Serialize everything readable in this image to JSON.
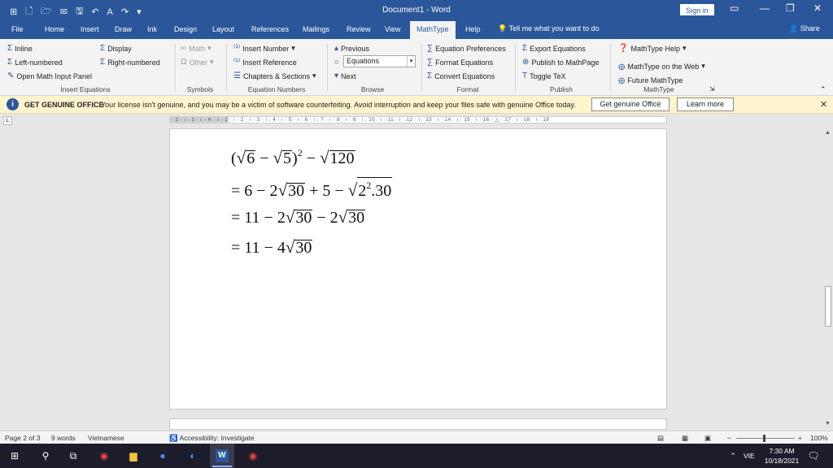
{
  "window": {
    "title": "Document1 - Word",
    "sign_in": "Sign in"
  },
  "tabs": [
    "File",
    "Home",
    "Insert",
    "Draw",
    "Ink",
    "Design",
    "Layout",
    "References",
    "Mailings",
    "Review",
    "View",
    "MathType",
    "Help"
  ],
  "active_tab": "MathType",
  "tell_me": "Tell me what you want to do",
  "share": "Share",
  "ribbon": {
    "insert_equations": {
      "label": "Insert Equations",
      "inline": "Inline",
      "display": "Display",
      "left_numbered": "Left-numbered",
      "right_numbered": "Right-numbered",
      "open_math_input": "Open Math Input Panel"
    },
    "symbols": {
      "label": "Symbols",
      "math": "Math",
      "other": "Other"
    },
    "equation_numbers": {
      "label": "Equation Numbers",
      "insert_number": "Insert Number",
      "insert_reference": "Insert Reference",
      "chapters_sections": "Chapters & Sections"
    },
    "browse": {
      "label": "Browse",
      "previous": "Previous",
      "combo_value": "Equations",
      "next": "Next"
    },
    "format": {
      "label": "Format",
      "equation_preferences": "Equation Preferences",
      "format_equations": "Format Equations",
      "convert_equations": "Convert Equations"
    },
    "publish": {
      "label": "Publish",
      "export_equations": "Export Equations",
      "publish_mathpage": "Publish to MathPage",
      "toggle_tex": "Toggle TeX"
    },
    "mathtype": {
      "label": "MathType",
      "help": "MathType Help",
      "on_web": "MathType on the Web",
      "future": "Future MathType"
    }
  },
  "license_bar": {
    "title": "GET GENUINE OFFICE",
    "message": "Your license isn't genuine, and you may be a victim of software counterfeiting. Avoid interruption and keep your files safe with genuine Office today.",
    "primary_button": "Get genuine Office",
    "secondary_button": "Learn more"
  },
  "ruler": {
    "text": "· 2 · ı · 1 · ı · ✕ · ı · 1 · ı · 2 · ı · 3 · ı · 4 · ı · 5 · ı · 6 · ı · 7 · ı · 8 · ı · 9 · ı · 10 · ı · 11 · ı · 12 · ı · 13 · ı · 14 · ı · 15 · ı · 16 · △ · 17 · ı · 18 · ı · 19"
  },
  "document": {
    "equations": [
      {
        "id": "line1",
        "parts": [
          "(",
          "√",
          "6",
          " − ",
          "√",
          "5",
          ")",
          "2",
          " − ",
          "√",
          "120"
        ]
      },
      {
        "id": "line2",
        "parts": [
          "= 6 − 2",
          "√",
          "30",
          " + 5 − ",
          "√",
          "2",
          "2",
          ".30"
        ]
      },
      {
        "id": "line3",
        "parts": [
          "= 11 − 2",
          "√",
          "30",
          " − 2",
          "√",
          "30"
        ]
      },
      {
        "id": "line4",
        "parts": [
          "= 11 − 4",
          "√",
          "30"
        ]
      }
    ]
  },
  "status": {
    "page": "Page 2 of 3",
    "words": "9 words",
    "language": "Vietnamese",
    "accessibility": "Accessibility: Investigate",
    "zoom": "100%"
  },
  "taskbar": {
    "language": "VIE",
    "time": "7:30 AM",
    "date": "10/18/2021"
  },
  "colors": {
    "word_blue": "#2b579a",
    "license_bar": "#fff4ce",
    "taskbar": "#1c1c2b"
  }
}
